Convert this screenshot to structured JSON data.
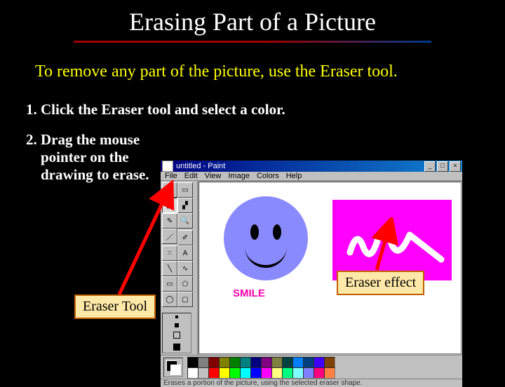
{
  "title": "Erasing Part of a Picture",
  "intro": "To remove any part of the picture, use the Eraser tool.",
  "steps": {
    "s1": "Click the Eraser tool and select a color.",
    "s2": "Drag the mouse pointer on the drawing to erase."
  },
  "paint": {
    "titlebar": "untitled - Paint",
    "win_buttons": {
      "min": "_",
      "max": "□",
      "close": "×"
    },
    "menu": {
      "file": "File",
      "edit": "Edit",
      "view": "View",
      "image": "Image",
      "colors": "Colors",
      "help": "Help"
    },
    "toolbox_icons": {
      "freeform": "✧",
      "select": "▭",
      "eraser": "◧",
      "fill": "▞",
      "pick": "✎",
      "zoom": "🔍",
      "pencil": "／",
      "brush": "✐",
      "spray": "⁙",
      "text": "A",
      "line": "╲",
      "curve": "∿",
      "rect": "▭",
      "poly": "⬠",
      "ellipse": "◯",
      "rrect": "▢"
    },
    "canvas": {
      "smile_label": "SMILE"
    },
    "palette_colors": [
      "#000000",
      "#808080",
      "#800000",
      "#808000",
      "#008000",
      "#008080",
      "#000080",
      "#800080",
      "#808040",
      "#004040",
      "#0080ff",
      "#004080",
      "#4000ff",
      "#804000",
      "#ffffff",
      "#c0c0c0",
      "#ff0000",
      "#ffff00",
      "#00ff00",
      "#00ffff",
      "#0000ff",
      "#ff00ff",
      "#ffff80",
      "#00ff80",
      "#80ffff",
      "#8080ff",
      "#ff0080",
      "#ff8040"
    ],
    "status": "Erases a portion of the picture, using the selected eraser shape."
  },
  "callouts": {
    "eraser_tool": "Eraser Tool",
    "eraser_effect": "Eraser effect"
  }
}
